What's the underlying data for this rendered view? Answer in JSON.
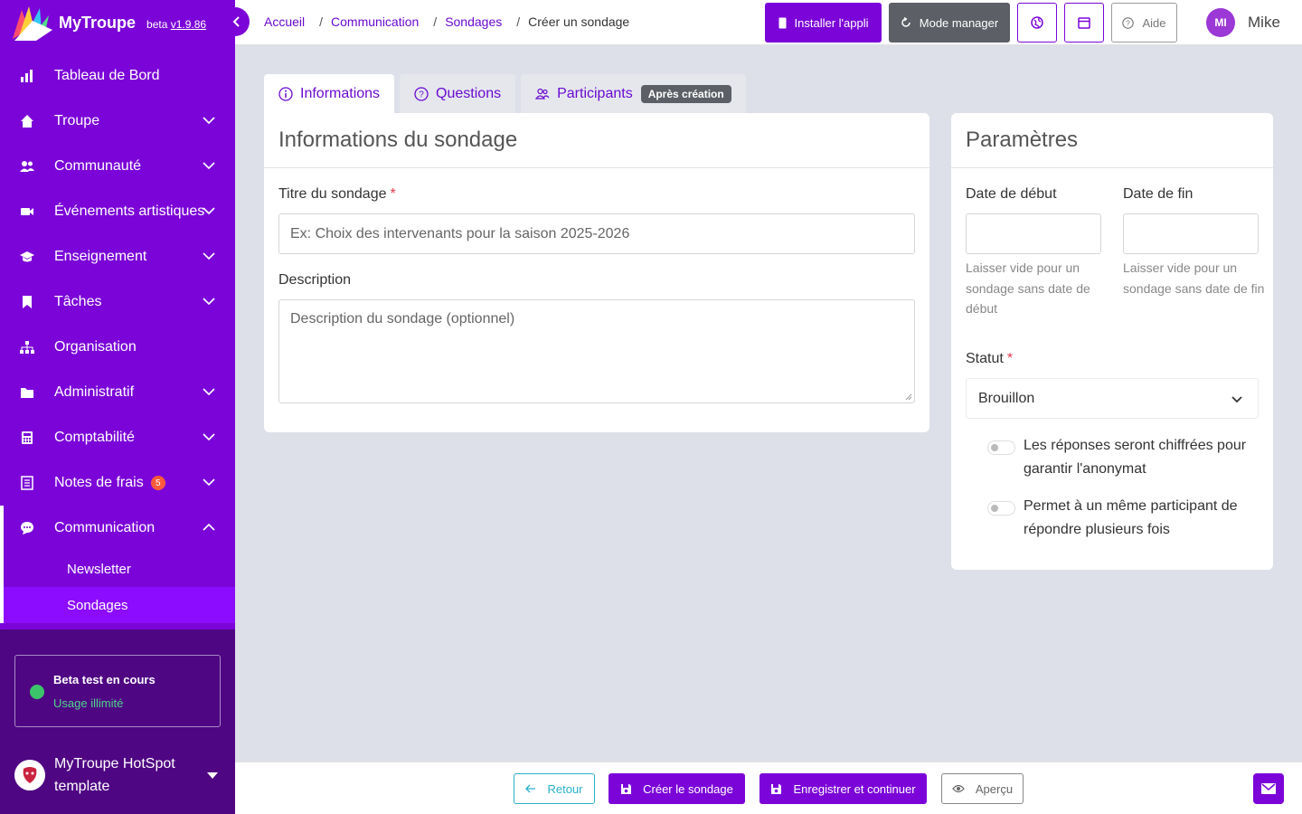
{
  "brand": {
    "name": "MyTroupe",
    "beta_prefix": "beta",
    "version": "v1.9.86"
  },
  "sidebar": {
    "items": [
      {
        "label": "Tableau de Bord",
        "icon": "chart-bar-icon"
      },
      {
        "label": "Troupe",
        "icon": "home-icon"
      },
      {
        "label": "Communauté",
        "icon": "users-icon"
      },
      {
        "label": "Événements artistiques",
        "icon": "video-icon"
      },
      {
        "label": "Enseignement",
        "icon": "graduation-cap-icon"
      },
      {
        "label": "Tâches",
        "icon": "bookmark-icon"
      },
      {
        "label": "Organisation",
        "icon": "sitemap-icon"
      },
      {
        "label": "Administratif",
        "icon": "folder-icon"
      },
      {
        "label": "Comptabilité",
        "icon": "calculator-icon"
      },
      {
        "label": "Notes de frais",
        "icon": "receipt-icon",
        "badge": "5"
      },
      {
        "label": "Communication",
        "icon": "chat-icon"
      }
    ],
    "subitems": [
      {
        "label": "Newsletter"
      },
      {
        "label": "Sondages"
      }
    ],
    "beta": {
      "title": "Beta test en cours",
      "subtitle": "Usage illimité"
    },
    "org": {
      "name": "MyTroupe HotSpot template"
    }
  },
  "breadcrumb": [
    "Accueil",
    "Communication",
    "Sondages",
    "Créer un sondage"
  ],
  "header": {
    "install_label": "Installer l'appli",
    "manager_label": "Mode manager",
    "help_label": "Aide",
    "user_initials": "MI",
    "user_name": "Mike"
  },
  "tabs": [
    {
      "label": "Informations",
      "icon": "info-circle-icon"
    },
    {
      "label": "Questions",
      "icon": "question-circle-icon"
    },
    {
      "label": "Participants",
      "icon": "people-icon",
      "tag": "Après création"
    }
  ],
  "form": {
    "card_title": "Informations du sondage",
    "title_label": "Titre du sondage",
    "title_placeholder": "Ex: Choix des intervenants pour la saison 2025-2026",
    "description_label": "Description",
    "description_placeholder": "Description du sondage (optionnel)"
  },
  "params": {
    "card_title": "Paramètres",
    "start_label": "Date de début",
    "end_label": "Date de fin",
    "start_help": "Laisser vide pour un sondage sans date de début",
    "end_help": "Laisser vide pour un sondage sans date de fin",
    "status_label": "Statut",
    "status_value": "Brouillon",
    "toggle_anonymous": "Les réponses seront chiffrées pour garantir l'anonymat",
    "toggle_multiple": "Permet à un même participant de répondre plusieurs fois"
  },
  "footer": {
    "back_label": "Retour",
    "create_label": "Créer le sondage",
    "save_label": "Enregistrer et continuer",
    "preview_label": "Aperçu"
  },
  "colors": {
    "primary": "#7b05d8",
    "sidebar_bottom": "#4f0683",
    "active_sub": "#8c0cff",
    "required": "#e03a4a",
    "success": "#3cc46b"
  }
}
